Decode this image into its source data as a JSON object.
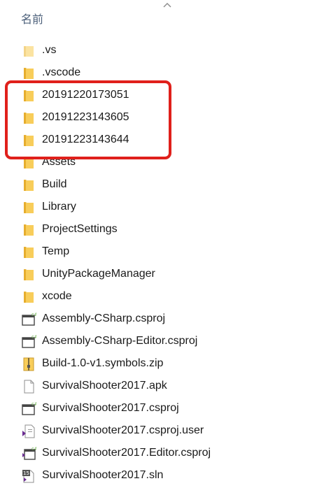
{
  "header": {
    "name_column": "名前",
    "sort_icon": "chevron-up-icon"
  },
  "files": [
    {
      "name": ".vs",
      "type": "folder-faded"
    },
    {
      "name": ".vscode",
      "type": "folder"
    },
    {
      "name": "20191220173051",
      "type": "folder"
    },
    {
      "name": "20191223143605",
      "type": "folder"
    },
    {
      "name": "20191223143644",
      "type": "folder"
    },
    {
      "name": "Assets",
      "type": "folder"
    },
    {
      "name": "Build",
      "type": "folder"
    },
    {
      "name": "Library",
      "type": "folder"
    },
    {
      "name": "ProjectSettings",
      "type": "folder"
    },
    {
      "name": "Temp",
      "type": "folder"
    },
    {
      "name": "UnityPackageManager",
      "type": "folder"
    },
    {
      "name": "xcode",
      "type": "folder"
    },
    {
      "name": "Assembly-CSharp.csproj",
      "type": "csproj"
    },
    {
      "name": "Assembly-CSharp-Editor.csproj",
      "type": "csproj"
    },
    {
      "name": "Build-1.0-v1.symbols.zip",
      "type": "zip"
    },
    {
      "name": "SurvivalShooter2017.apk",
      "type": "file"
    },
    {
      "name": "SurvivalShooter2017.csproj",
      "type": "csproj"
    },
    {
      "name": "SurvivalShooter2017.csproj.user",
      "type": "vs-user"
    },
    {
      "name": "SurvivalShooter2017.Editor.csproj",
      "type": "csproj-vs"
    },
    {
      "name": "SurvivalShooter2017.sln",
      "type": "sln"
    }
  ],
  "colors": {
    "folder": "#f8cd5a",
    "folder_dark": "#e8b33a",
    "highlight": "#e0201b",
    "csharp_green": "#6ab04c",
    "vs_purple": "#6a2c91"
  }
}
